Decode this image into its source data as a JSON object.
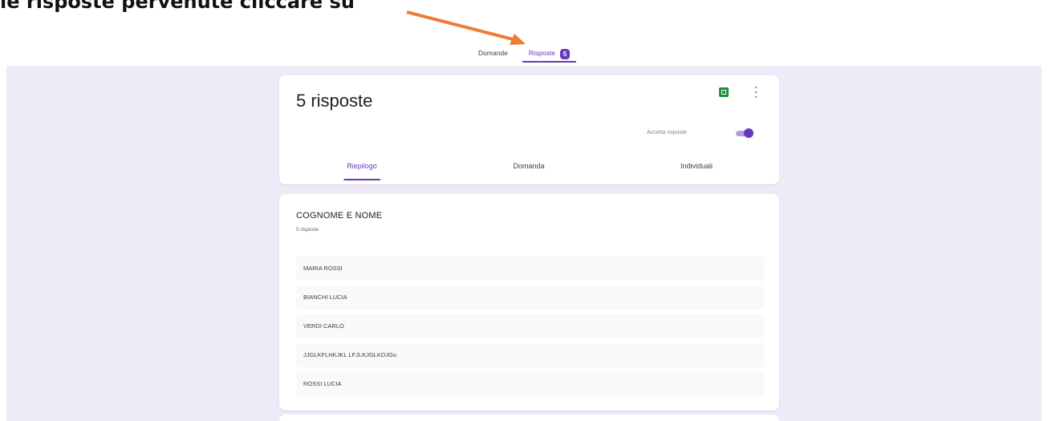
{
  "caption": "le risposte pervenute cliccare su",
  "top_tabs": {
    "questions": "Domande",
    "responses": "Risposte",
    "responses_count": "5"
  },
  "summary": {
    "title": "5 risposte",
    "accept_label": "Accetta risposte",
    "accept_on": true,
    "tabs": [
      "Riepilogo",
      "Domanda",
      "Individuali"
    ]
  },
  "question": {
    "title": "COGNOME E NOME",
    "count_label": "5 risposte",
    "answers": [
      "MARIA ROSSI",
      "BIANCHI LUCIA",
      "VERDI CARLO",
      "JJGLKFLHKJKL LFJLKJGLKDJGo",
      "ROSSI LUCIA"
    ]
  },
  "colors": {
    "accent": "#673ab7",
    "background": "#efeaf8",
    "arrow": "#ed7d31",
    "sheets": "#1e8e3e"
  },
  "icons": {
    "sheets": "google-sheets-icon",
    "menu": "more-vert-icon"
  }
}
